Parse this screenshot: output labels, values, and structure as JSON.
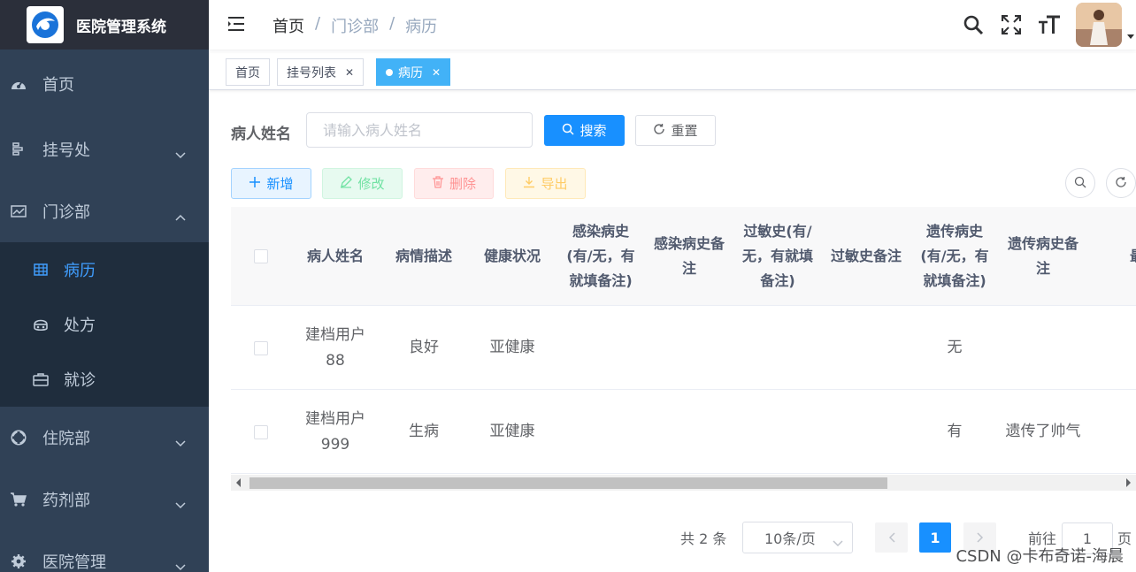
{
  "app": {
    "title": "医院管理系统"
  },
  "sidebar": {
    "items": [
      {
        "label": "首页",
        "icon": "dashboard-icon",
        "has_arrow": false
      },
      {
        "label": "挂号处",
        "icon": "register-icon",
        "has_arrow": true,
        "expanded": false
      },
      {
        "label": "门诊部",
        "icon": "clinic-icon",
        "has_arrow": true,
        "expanded": true,
        "children": [
          {
            "label": "病历",
            "icon": "table-icon",
            "active": true
          },
          {
            "label": "处方",
            "icon": "prescription-icon"
          },
          {
            "label": "就诊",
            "icon": "briefcase-icon"
          }
        ]
      },
      {
        "label": "住院部",
        "icon": "inpatient-icon",
        "has_arrow": true,
        "expanded": false
      },
      {
        "label": "药剂部",
        "icon": "cart-icon",
        "has_arrow": true,
        "expanded": false
      },
      {
        "label": "医院管理",
        "icon": "gear-icon",
        "has_arrow": true,
        "expanded": false
      }
    ]
  },
  "navbar": {
    "breadcrumb": [
      "首页",
      "/",
      "门诊部",
      "/",
      "病历"
    ]
  },
  "tags": [
    {
      "label": "首页",
      "closable": false,
      "active": false
    },
    {
      "label": "挂号列表",
      "closable": true,
      "active": false
    },
    {
      "label": "病历",
      "closable": true,
      "active": true
    }
  ],
  "search": {
    "label": "病人姓名",
    "placeholder": "请输入病人姓名",
    "value": "",
    "search_button": "搜索",
    "reset_button": "重置"
  },
  "toolbar": {
    "add": "新增",
    "edit": "修改",
    "delete": "删除",
    "export": "导出"
  },
  "table": {
    "columns": [
      "病人姓名",
      "病情描述",
      "健康状况",
      "感染病史(有/无，有就填备注)",
      "感染病史备注",
      "过敏史(有/无，有就填备注)",
      "过敏史备注",
      "遗传病史(有/无，有就填备注)",
      "遗传病史备注",
      "最"
    ],
    "rows": [
      [
        "建档用户88",
        "良好",
        "亚健康",
        "",
        "",
        "",
        "",
        "无",
        "",
        ""
      ],
      [
        "建档用户999",
        "生病",
        "亚健康",
        "",
        "",
        "",
        "",
        "有",
        "遗传了帅气",
        ""
      ]
    ]
  },
  "pagination": {
    "total_text": "共 2 条",
    "page_size": "10条/页",
    "current_page": "1",
    "goto_prefix": "前往",
    "goto_value": "1",
    "goto_suffix": "页"
  },
  "watermark": "CSDN @卡布奇诺-海晨",
  "colors": {
    "sidebar_bg": "#304156",
    "submenu_bg": "#1f2d3d",
    "active_text": "#409eff",
    "primary": "#1890ff",
    "tag_active": "#42b2f7"
  }
}
